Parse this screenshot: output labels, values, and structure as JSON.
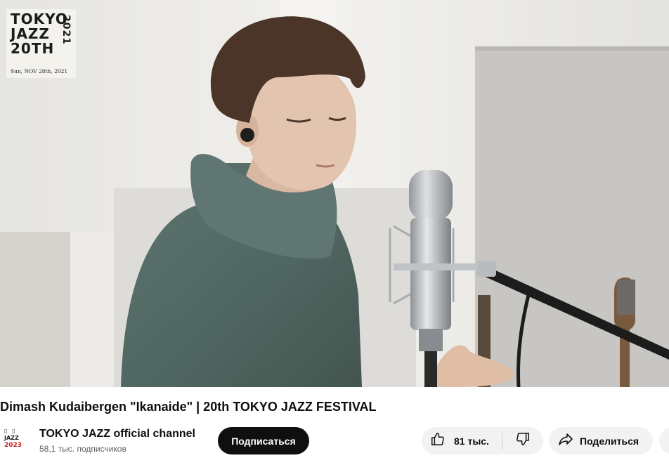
{
  "video": {
    "overlay_logo": {
      "line1": "TOKYO",
      "line2": "JAZZ",
      "line3": "20TH",
      "year": "2021",
      "date": "Sun, NOV 28th, 2021"
    }
  },
  "title": "Dimash Kudaibergen \"Ikanaide\" | 20th TOKYO JAZZ FESTIVAL",
  "channel": {
    "avatar_top": "▯ ▯",
    "avatar_mid": "JAZZ",
    "avatar_bot": "2023",
    "name": "TOKYO JAZZ official channel",
    "subscribers": "58,1 тыс. подписчиков"
  },
  "actions": {
    "subscribe_label": "Подписаться",
    "like_count": "81 тыс.",
    "share_label": "Поделиться",
    "icons": [
      "thumbs-up-icon",
      "thumbs-down-icon",
      "share-arrow-icon"
    ]
  }
}
